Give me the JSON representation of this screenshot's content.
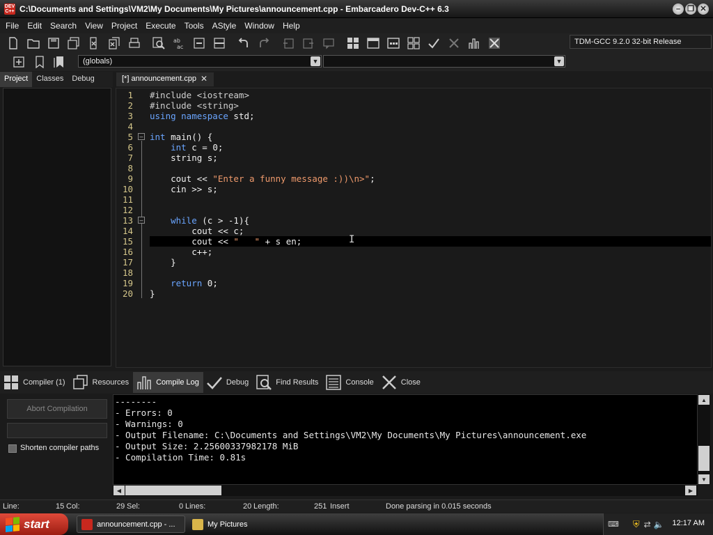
{
  "window": {
    "title": "C:\\Documents and Settings\\VM2\\My Documents\\My Pictures\\announcement.cpp - Embarcadero Dev-C++ 6.3",
    "app_icon_text": "DEV C++",
    "controls": [
      "minimize",
      "restore",
      "close"
    ]
  },
  "menu": [
    "File",
    "Edit",
    "Search",
    "View",
    "Project",
    "Execute",
    "Tools",
    "AStyle",
    "Window",
    "Help"
  ],
  "toolbar": {
    "compiler_select": "TDM-GCC 9.2.0 32-bit Release",
    "globals_select": "(globals)",
    "member_select": ""
  },
  "left_panel": {
    "tabs": [
      "Project",
      "Classes",
      "Debug"
    ],
    "active_tab": "Project"
  },
  "editor": {
    "tab_label": "[*] announcement.cpp",
    "lines": [
      {
        "n": "1",
        "tokens": [
          {
            "t": "#include <iostream>",
            "c": "pp"
          }
        ]
      },
      {
        "n": "2",
        "tokens": [
          {
            "t": "#include <string>",
            "c": "pp"
          }
        ]
      },
      {
        "n": "3",
        "tokens": [
          {
            "t": "using namespace",
            "c": "kw"
          },
          {
            "t": " std;",
            "c": "tx"
          }
        ]
      },
      {
        "n": "4",
        "tokens": []
      },
      {
        "n": "5",
        "tokens": [
          {
            "t": "int",
            "c": "kw"
          },
          {
            "t": " main() {",
            "c": "tx"
          }
        ]
      },
      {
        "n": "6",
        "tokens": [
          {
            "t": "    ",
            "c": "tx"
          },
          {
            "t": "int",
            "c": "kw"
          },
          {
            "t": " c = 0;",
            "c": "tx"
          }
        ]
      },
      {
        "n": "7",
        "tokens": [
          {
            "t": "    string s;",
            "c": "tx"
          }
        ]
      },
      {
        "n": "8",
        "tokens": []
      },
      {
        "n": "9",
        "tokens": [
          {
            "t": "    cout << ",
            "c": "tx"
          },
          {
            "t": "\"Enter a funny message :))\\n>\"",
            "c": "str"
          },
          {
            "t": ";",
            "c": "tx"
          }
        ]
      },
      {
        "n": "10",
        "tokens": [
          {
            "t": "    cin >> s;",
            "c": "tx"
          }
        ]
      },
      {
        "n": "11",
        "tokens": []
      },
      {
        "n": "12",
        "tokens": []
      },
      {
        "n": "13",
        "tokens": [
          {
            "t": "    ",
            "c": "tx"
          },
          {
            "t": "while",
            "c": "kw"
          },
          {
            "t": " (c > -1){",
            "c": "tx"
          }
        ]
      },
      {
        "n": "14",
        "tokens": [
          {
            "t": "        cout << c;",
            "c": "tx"
          }
        ]
      },
      {
        "n": "15",
        "tokens": [
          {
            "t": "        cout << ",
            "c": "tx"
          },
          {
            "t": "\"   \"",
            "c": "str"
          },
          {
            "t": " + s en;",
            "c": "tx"
          }
        ]
      },
      {
        "n": "16",
        "tokens": [
          {
            "t": "        c++;",
            "c": "tx"
          }
        ]
      },
      {
        "n": "17",
        "tokens": [
          {
            "t": "    }",
            "c": "tx"
          }
        ]
      },
      {
        "n": "18",
        "tokens": []
      },
      {
        "n": "19",
        "tokens": [
          {
            "t": "    ",
            "c": "tx"
          },
          {
            "t": "return",
            "c": "kw"
          },
          {
            "t": " 0;",
            "c": "tx"
          }
        ]
      },
      {
        "n": "20",
        "tokens": [
          {
            "t": "}",
            "c": "tx"
          }
        ]
      }
    ],
    "highlighted_line": 15
  },
  "bottom_tabs": [
    {
      "label": "Compiler (1)",
      "icon": "grid-icon"
    },
    {
      "label": "Resources",
      "icon": "resources-icon"
    },
    {
      "label": "Compile Log",
      "icon": "bar-chart-icon",
      "active": true
    },
    {
      "label": "Debug",
      "icon": "check-icon"
    },
    {
      "label": "Find Results",
      "icon": "find-icon"
    },
    {
      "label": "Console",
      "icon": "console-icon"
    },
    {
      "label": "Close",
      "icon": "close-icon"
    }
  ],
  "compile_panel": {
    "abort_label": "Abort Compilation",
    "shorten_label": "Shorten compiler paths",
    "log": [
      "--------",
      "- Errors: 0",
      "- Warnings: 0",
      "- Output Filename: C:\\Documents and Settings\\VM2\\My Documents\\My Pictures\\announcement.exe",
      "- Output Size: 2.25600337982178 MiB",
      "- Compilation Time: 0.81s"
    ]
  },
  "status": {
    "line_label": "Line:",
    "line_value": "15",
    "col_label": "Col:",
    "col_value": "29",
    "sel_label": "Sel:",
    "sel_value": "0",
    "lines_label": "Lines:",
    "lines_value": "20",
    "length_label": "Length:",
    "length_value": "251",
    "mode": "Insert",
    "message": "Done parsing in 0.015 seconds"
  },
  "taskbar": {
    "start_label": "start",
    "tasks": [
      "announcement.cpp - ...",
      "My Pictures"
    ],
    "clock": "12:17 AM"
  },
  "colors": {
    "keyword": "#6aa5ff",
    "string": "#ef9a6c",
    "line_number": "#d4c68a",
    "start_button": "#c8281e"
  }
}
